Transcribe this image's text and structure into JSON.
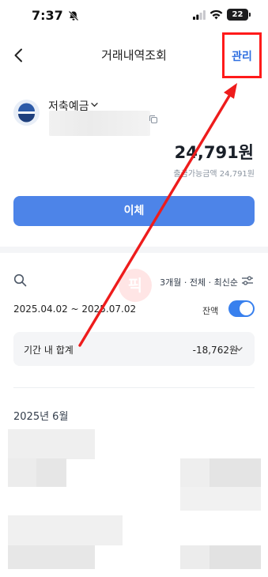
{
  "status_bar": {
    "time": "7:37",
    "battery": "22"
  },
  "header": {
    "title": "거래내역조회",
    "manage_label": "관리"
  },
  "account": {
    "name": "저축예금",
    "balance": "24,791원",
    "withdrawable": "출금가능금액 24,791원"
  },
  "transfer_button": "이체",
  "filter": {
    "summary": "3개월 · 전체 · 최신순",
    "date_range": "2025.04.02 ~ 2025.07.02",
    "balance_toggle_label": "잔액",
    "balance_toggle_on": true
  },
  "period_total": {
    "label": "기간 내 합계",
    "value": "-18,762원"
  },
  "month_header": "2025년 6월",
  "watermark": "픽",
  "colors": {
    "accent": "#4d84e8",
    "annotation": "#ff1a1a"
  }
}
